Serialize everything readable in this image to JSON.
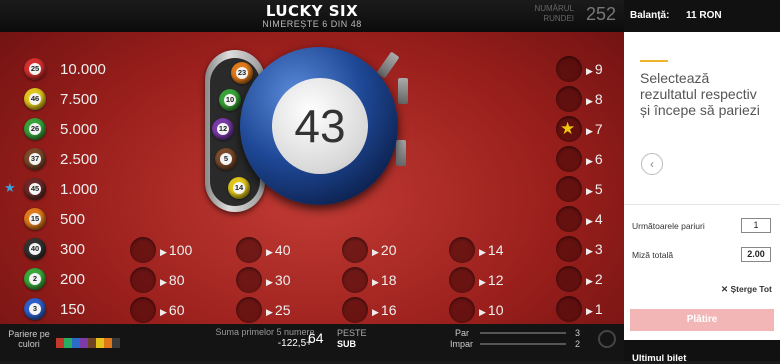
{
  "header": {
    "title": "LUCKY SIX",
    "subtitle": "NIMEREȘTE 6 DIN 48",
    "round_label": "NUMĂRUL RUNDEI",
    "round_number": "252"
  },
  "drawn_balls": [
    {
      "number": "25",
      "odds": "10.000",
      "color": "#d62f2f"
    },
    {
      "number": "46",
      "odds": "7.500",
      "color": "#e0c51c"
    },
    {
      "number": "26",
      "odds": "5.000",
      "color": "#39a339"
    },
    {
      "number": "37",
      "odds": "2.500",
      "color": "#7a4a2a"
    },
    {
      "number": "45",
      "odds": "1.000",
      "color": "#6a2a2a"
    },
    {
      "number": "15",
      "odds": "500",
      "color": "#e07a1a"
    },
    {
      "number": "40",
      "odds": "300",
      "color": "#333333"
    },
    {
      "number": "2",
      "odds": "200",
      "color": "#3aa83a"
    },
    {
      "number": "3",
      "odds": "150",
      "color": "#2f5fc9"
    }
  ],
  "current_ball": {
    "number": "43",
    "color": "#1e4896"
  },
  "tube_balls": [
    {
      "number": "23",
      "color": "#e07a1a"
    },
    {
      "number": "10",
      "color": "#39a339"
    },
    {
      "number": "12",
      "color": "#7a3aa8"
    },
    {
      "number": "5",
      "color": "#7a4a2a"
    },
    {
      "number": "14",
      "color": "#e0c51c"
    }
  ],
  "bet_columns": [
    [
      "100",
      "80",
      "60"
    ],
    [
      "40",
      "30",
      "25"
    ],
    [
      "20",
      "18",
      "16"
    ],
    [
      "14",
      "12",
      "10"
    ]
  ],
  "right_column": [
    "9",
    "8",
    "7",
    "6",
    "5",
    "4",
    "3",
    "2",
    "1"
  ],
  "bottom": {
    "color_label": "Pariere pe culori",
    "sum_label": "Suma primelor 5 numere",
    "sum_value": "-122,5+",
    "sum_number": "64",
    "over_label": "PESTE",
    "over_value": "SUB",
    "even_label": "Par",
    "even_value": "3",
    "odd_label": "Impar",
    "odd_value": "2"
  },
  "panel": {
    "balance_label": "Balanță:",
    "balance_value": "11 RON",
    "prompt": "Selectează rezultatul respectiv și începe să pariezi",
    "next_bets_label": "Următoarele pariuri",
    "next_bets_value": "1",
    "stake_label": "Miză totală",
    "stake_value": "2.00",
    "clear_all": "Șterge Tot",
    "place_bet": "Plătire",
    "last_ticket": "Ultimul bilet"
  },
  "colors": {
    "accent": "#f0b429",
    "board_red": "#9a1f1c",
    "star_gold": "#f1c40f",
    "star_blue": "#3aa0e0"
  }
}
